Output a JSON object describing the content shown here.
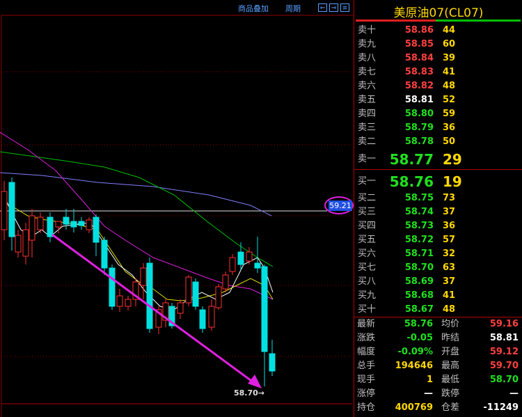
{
  "toolbar": {
    "overlay_label": "商品叠加",
    "period_label": "周期",
    "btn_left": "⇐",
    "btn_right": "⇒",
    "btn_menu": "≡"
  },
  "chart": {
    "current_price_tag": "59.21",
    "low_label": "58.70→",
    "colors": {
      "up_candle": "#ff3030",
      "down_candle": "#00e0e0",
      "ma_white": "#ffffff",
      "ma_yellow": "#e0e000",
      "ma_magenta": "#e020e0",
      "ma_green": "#00c000",
      "ma_blue": "#8080ff",
      "arrow": "#e020e0",
      "grid": "#900000"
    }
  },
  "panel": {
    "title": "美原油07(CL07)",
    "asks": [
      {
        "label": "卖十",
        "price": "58.86",
        "vol": "44",
        "color": "red"
      },
      {
        "label": "卖九",
        "price": "58.85",
        "vol": "60",
        "color": "red"
      },
      {
        "label": "卖八",
        "price": "58.84",
        "vol": "39",
        "color": "red"
      },
      {
        "label": "卖七",
        "price": "58.83",
        "vol": "41",
        "color": "red"
      },
      {
        "label": "卖六",
        "price": "58.82",
        "vol": "48",
        "color": "red"
      },
      {
        "label": "卖五",
        "price": "58.81",
        "vol": "52",
        "color": "white"
      },
      {
        "label": "卖四",
        "price": "58.80",
        "vol": "59",
        "color": "green"
      },
      {
        "label": "卖三",
        "price": "58.79",
        "vol": "36",
        "color": "green"
      },
      {
        "label": "卖二",
        "price": "58.78",
        "vol": "50",
        "color": "green"
      }
    ],
    "ask1": {
      "label": "卖一",
      "price": "58.77",
      "vol": "29"
    },
    "bid1": {
      "label": "买一",
      "price": "58.76",
      "vol": "19"
    },
    "bids": [
      {
        "label": "买二",
        "price": "58.75",
        "vol": "73"
      },
      {
        "label": "买三",
        "price": "58.74",
        "vol": "37"
      },
      {
        "label": "买四",
        "price": "58.73",
        "vol": "36"
      },
      {
        "label": "买五",
        "price": "58.72",
        "vol": "57"
      },
      {
        "label": "买六",
        "price": "58.71",
        "vol": "32"
      },
      {
        "label": "买七",
        "price": "58.70",
        "vol": "63"
      },
      {
        "label": "买八",
        "price": "58.69",
        "vol": "37"
      },
      {
        "label": "买九",
        "price": "58.68",
        "vol": "41"
      },
      {
        "label": "买十",
        "price": "58.67",
        "vol": "48"
      }
    ],
    "stats": [
      {
        "l1": "最新",
        "v1": "58.76",
        "c1": "green",
        "l2": "均价",
        "v2": "59.16",
        "c2": "red"
      },
      {
        "l1": "涨跌",
        "v1": "-0.05",
        "c1": "green",
        "l2": "昨结",
        "v2": "58.81",
        "c2": "white"
      },
      {
        "l1": "幅度",
        "v1": "-0.09%",
        "c1": "green",
        "l2": "开盘",
        "v2": "59.12",
        "c2": "red"
      },
      {
        "l1": "总手",
        "v1": "194646",
        "c1": "yellow",
        "l2": "最高",
        "v2": "59.70",
        "c2": "red"
      },
      {
        "l1": "现手",
        "v1": "1",
        "c1": "yellow",
        "l2": "最低",
        "v2": "58.70",
        "c2": "green"
      },
      {
        "l1": "涨停",
        "v1": "—",
        "c1": "white",
        "l2": "跌停",
        "v2": "—",
        "c2": "white"
      },
      {
        "l1": "持仓",
        "v1": "400769",
        "c1": "yellow",
        "l2": "仓差",
        "v2": "-11249",
        "c2": "white"
      }
    ]
  }
}
